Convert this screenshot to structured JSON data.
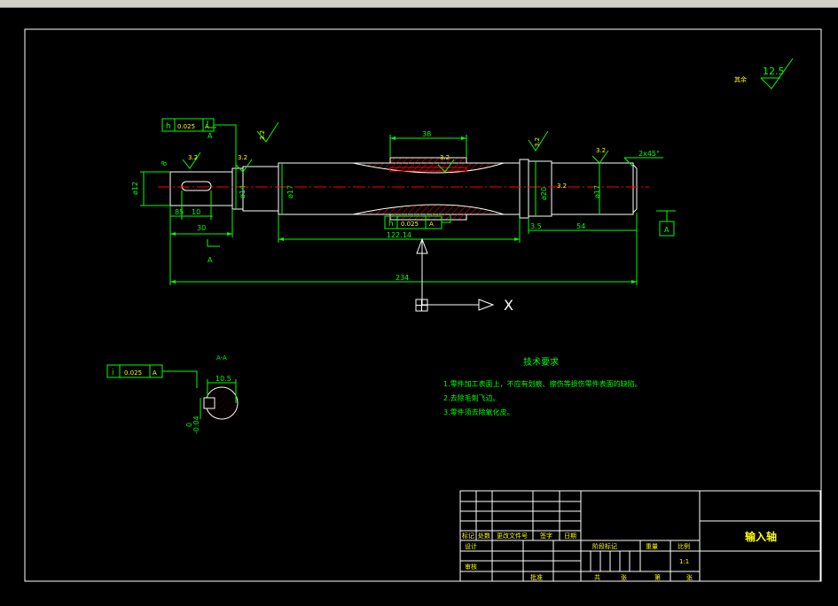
{
  "colors": {
    "background": "#000000",
    "border": "#ffffff",
    "geometry": "#ffffff",
    "dimension": "#00ff00",
    "centerline": "#ff0000",
    "hatch": "#ff0000",
    "tolerance_frame": "#00ff00",
    "title_text": "#ffff00",
    "ucs": "#ffffff"
  },
  "dimensions": {
    "d38": "38",
    "d12": "ø12",
    "d14": "ø14",
    "d17a": "ø17",
    "d20": "ø20",
    "d17b": "ø17",
    "d8": "8",
    "d85": "85",
    "d10": "10",
    "d30": "30",
    "d122": "122.14",
    "d35": "3.5",
    "d54": "54",
    "d234": "234",
    "chamfer": "2x45°",
    "d105": "10.5",
    "d0_04": "-0.04",
    "d0": "0"
  },
  "roughness": {
    "r1": "3.2",
    "r2": "3.2",
    "r3": "3.2",
    "r4": "3.2",
    "r5": "3.2",
    "r6": "3.2",
    "r7": "3.2",
    "general_value": "12.5",
    "general_label": "其余"
  },
  "tolerances": {
    "top": {
      "symbol": "h",
      "value": "0.025",
      "datum": "A"
    },
    "mid": {
      "symbol": "h",
      "value": "0.025",
      "datum": "A"
    },
    "section": {
      "symbol": "i",
      "value": "0.025",
      "datum": "A"
    }
  },
  "datums": {
    "top": "A",
    "bottom": "A",
    "right": "A"
  },
  "section_title": "A-A",
  "ucs_axis_label": "X",
  "tech_requirements": {
    "title": "技术要求",
    "items": [
      "1.零件加工表面上，不应有划痕、擦伤等损伤零件表面的缺陷。",
      "2.去除毛刺飞边。",
      "3.零件须去除氧化皮。"
    ]
  },
  "title_block": {
    "part_name": "输入轴",
    "scale": "1:1",
    "headers": [
      "标记",
      "处数",
      "更改文件号",
      "签字",
      "日期"
    ],
    "row_design": "设计",
    "row_check": "审核",
    "label_stage": "阶段标记",
    "label_weight": "重量",
    "label_scale": "比例",
    "label_total": "共",
    "label_sheet": "张",
    "label_approve": "批准",
    "label_sheet_no": "第"
  }
}
